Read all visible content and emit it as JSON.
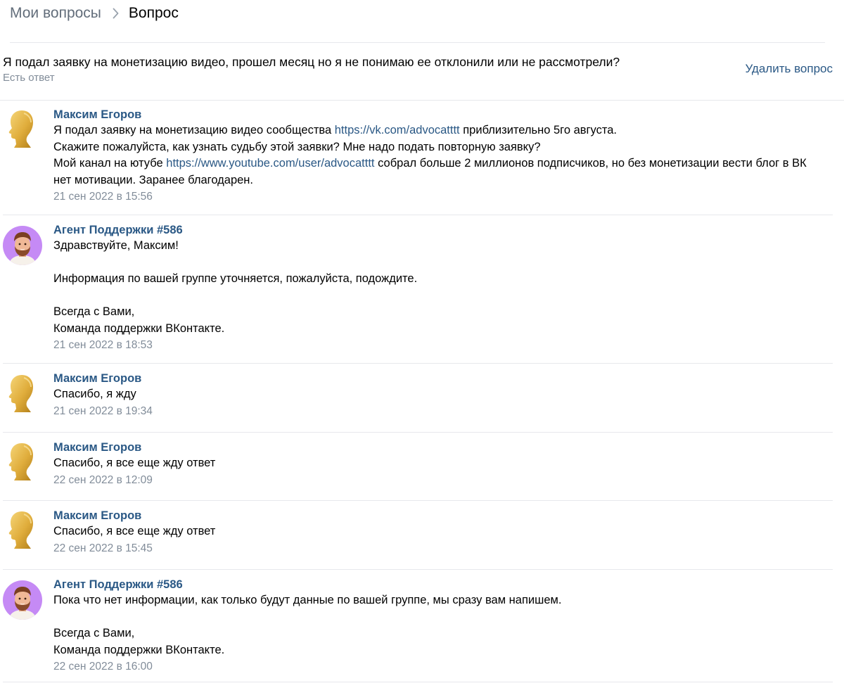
{
  "breadcrumb": {
    "parent": "Мои вопросы",
    "current": "Вопрос"
  },
  "question": {
    "title": "Я подал заявку на монетизацию видео, прошел месяц но я не понимаю ее отклонили или не рассмотрели?",
    "status": "Есть ответ",
    "delete_label": "Удалить вопрос"
  },
  "messages": [
    {
      "author": "Максим Егоров",
      "avatar": "gold-head-silhouette-icon",
      "line1_pre": "Я подал заявку на монетизацию видео сообщества ",
      "line1_link": "https://vk.com/advocatttt",
      "line1_post": " приблизительно 5го августа.",
      "line2": "Скажите пожалуйста, как узнать судьбу этой заявки? Мне надо подать повторную заявку?",
      "line3_pre": "Мой канал на ютубе ",
      "line3_link": "https://www.youtube.com/user/advocatttt",
      "line3_post": " собрал больше 2 миллионов подписчиков, но без монетизации вести блог в ВК",
      "line4": "нет мотивации. Заранее благодарен.",
      "time": "21 сен 2022 в 15:56"
    },
    {
      "author": "Агент Поддержки #586",
      "avatar": "support-agent-avatar-icon",
      "text": "Здравствуйте, Максим!\n\nИнформация по вашей группе уточняется, пожалуйста, подождите.\n\nВсегда с Вами,\nКоманда поддержки ВКонтакте.",
      "time": "21 сен 2022 в 18:53"
    },
    {
      "author": "Максим Егоров",
      "avatar": "gold-head-silhouette-icon",
      "text": "Спасибо, я жду",
      "time": "21 сен 2022 в 19:34"
    },
    {
      "author": "Максим Егоров",
      "avatar": "gold-head-silhouette-icon",
      "text": "Спасибо, я все еще жду ответ",
      "time": "22 сен 2022 в 12:09"
    },
    {
      "author": "Максим Егоров",
      "avatar": "gold-head-silhouette-icon",
      "text": "Спасибо, я все еще жду ответ",
      "time": "22 сен 2022 в 15:45"
    },
    {
      "author": "Агент Поддержки #586",
      "avatar": "support-agent-avatar-icon",
      "text": "Пока что нет информации, как только будут данные по вашей группе, мы сразу вам напишем.\n\nВсегда с Вами,\nКоманда поддержки ВКонтакте.",
      "time": "22 сен 2022 в 16:00"
    }
  ],
  "colors": {
    "link": "#2a5885",
    "muted": "#818c99",
    "divider": "#e7e8ec",
    "agent_avatar_bg": "#c58af5",
    "gold": "#e8b84a"
  }
}
